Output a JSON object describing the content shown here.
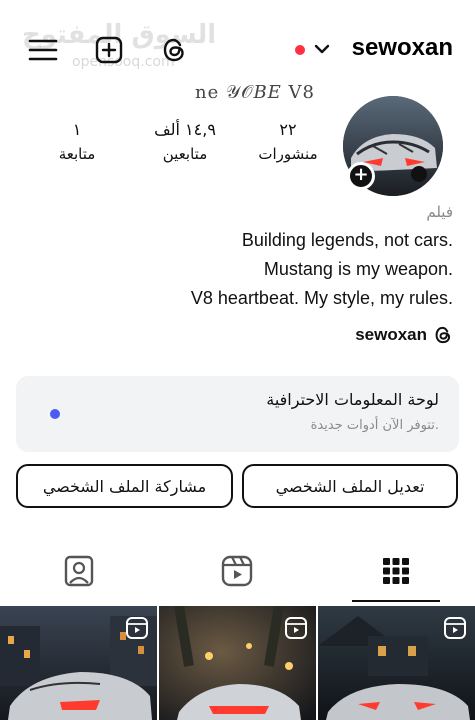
{
  "header": {
    "username": "sewoxan",
    "watermark": "السوق المفتوح",
    "watermark_sub": "opensooq.com",
    "name_strip": "ne 𝒴𝒪𝐵𝐸 V8"
  },
  "stats": {
    "posts_value": "٢٢",
    "posts_label": "منشورات",
    "followers_value": "١٤,٩ ألف",
    "followers_label": "متابعين",
    "following_value": "١",
    "following_label": "متابعة"
  },
  "bio": {
    "category": "فيلم",
    "line1": "Building legends, not cars.",
    "line2": "Mustang is my weapon.",
    "line3": "V8 heartbeat. My style, my rules.",
    "threads_handle": "sewoxan"
  },
  "dashboard": {
    "title": "لوحة المعلومات الاحترافية",
    "subtitle": "تتوفر الآن أدوات جديدة."
  },
  "buttons": {
    "edit_profile": "تعديل الملف الشخصي",
    "share_profile": "مشاركة الملف الشخصي"
  },
  "tabs": [
    "grid-icon",
    "reels-icon",
    "tagged-icon"
  ],
  "colors": {
    "notification_dot": "#ff3040",
    "dashboard_dot": "#4a5cf0",
    "card_bg": "#f2f3f5"
  }
}
